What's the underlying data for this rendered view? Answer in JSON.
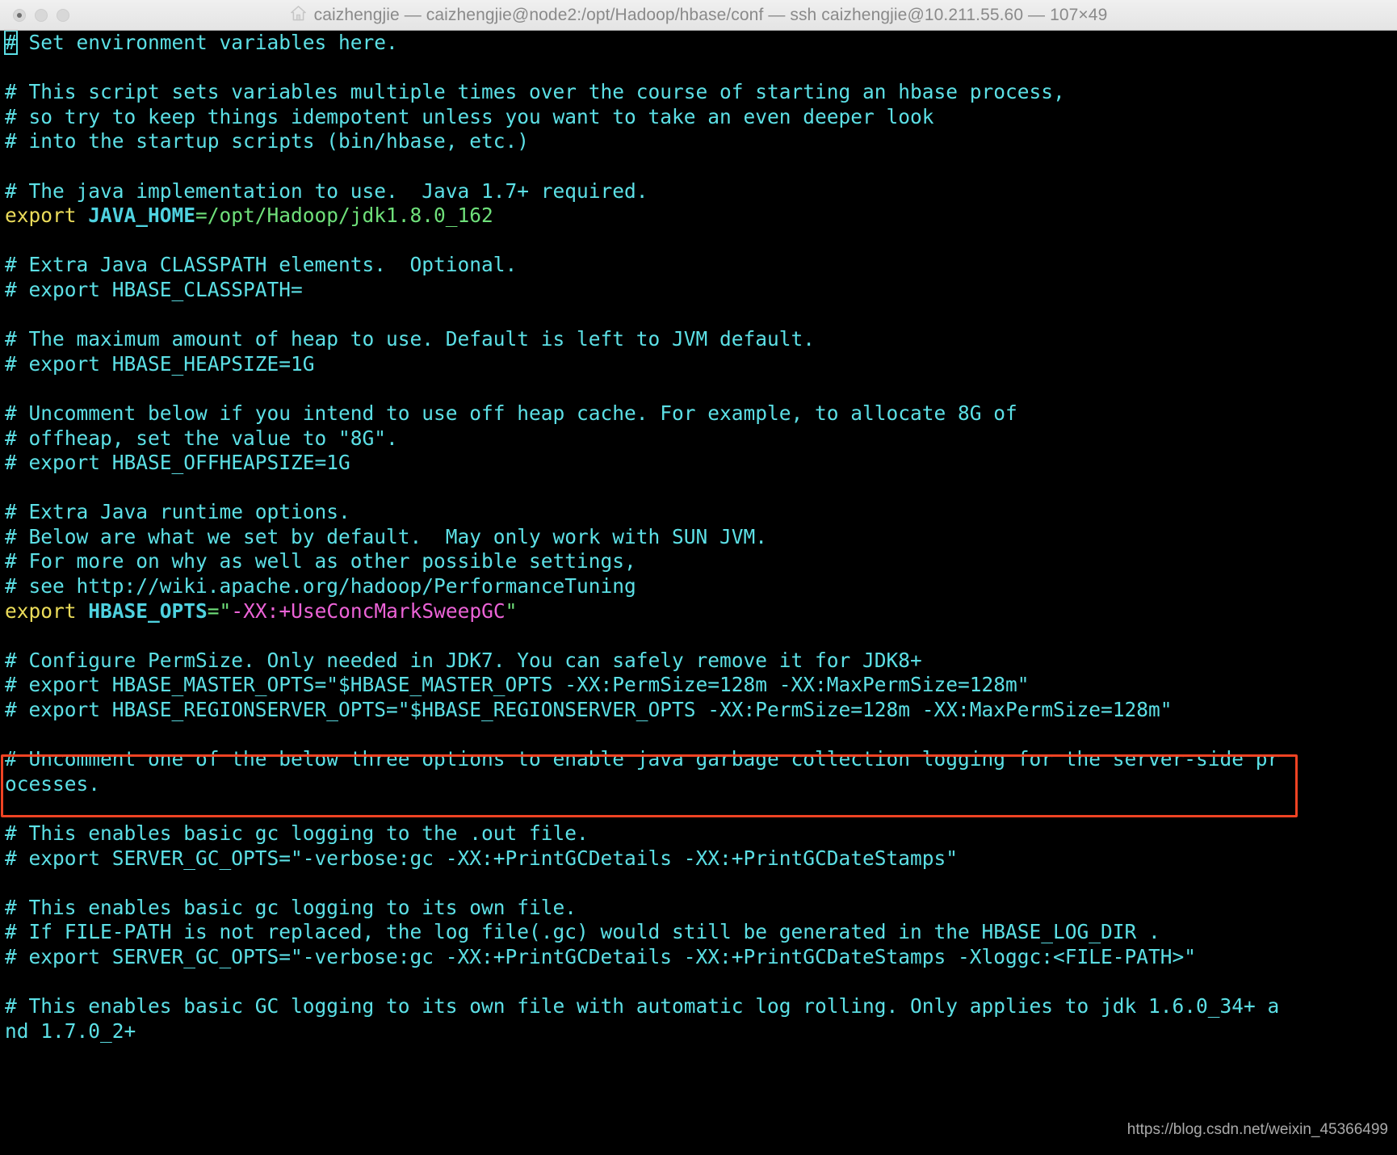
{
  "window": {
    "title": "caizhengjie — caizhengjie@node2:/opt/Hadoop/hbase/conf — ssh caizhengjie@10.211.55.60 — 107×49",
    "home_icon": "home-icon",
    "traffic_lights": [
      "close",
      "minimize",
      "zoom"
    ],
    "active": false
  },
  "theme": {
    "background": "#000000",
    "comment_color": "#5ce0e6",
    "keyword_color": "#ebdc5a",
    "variable_color": "#4fd2e0",
    "string_color": "#6fe07a",
    "value_color": "#ec63d7",
    "annotation_color": "#ef4323",
    "titlebar_bg": "#ebebeb",
    "titlebar_text": "#8a8a8a"
  },
  "annotation": {
    "type": "red-rectangle",
    "color": "#ef4323",
    "covers_lines": [
      28,
      29
    ]
  },
  "watermark": {
    "text": "https://blog.csdn.net/weixin_45366499"
  },
  "terminal": {
    "columns": 107,
    "rows": 49,
    "cursor": {
      "line": 0,
      "column": 0,
      "char": "#"
    },
    "lines": [
      {
        "segments": [
          {
            "t": "#",
            "c": "comment",
            "cursor": true
          },
          {
            "t": " Set environment variables here.",
            "c": "comment"
          }
        ]
      },
      {
        "segments": [
          {
            "t": "",
            "c": "comment"
          }
        ]
      },
      {
        "segments": [
          {
            "t": "# This script sets variables multiple times over the course of starting an hbase process,",
            "c": "comment"
          }
        ]
      },
      {
        "segments": [
          {
            "t": "# so try to keep things idempotent unless you want to take an even deeper look",
            "c": "comment"
          }
        ]
      },
      {
        "segments": [
          {
            "t": "# into the startup scripts (bin/hbase, etc.)",
            "c": "comment"
          }
        ]
      },
      {
        "segments": [
          {
            "t": "",
            "c": "comment"
          }
        ]
      },
      {
        "segments": [
          {
            "t": "# The java implementation to use.  Java 1.7+ required.",
            "c": "comment"
          }
        ]
      },
      {
        "segments": [
          {
            "t": "export",
            "c": "keyword"
          },
          {
            "t": " ",
            "c": "comment"
          },
          {
            "t": "JAVA_HOME",
            "c": "var"
          },
          {
            "t": "=/opt/Hadoop/jdk1.8.0_162",
            "c": "green"
          }
        ]
      },
      {
        "segments": [
          {
            "t": "",
            "c": "comment"
          }
        ]
      },
      {
        "segments": [
          {
            "t": "# Extra Java CLASSPATH elements.  Optional.",
            "c": "comment"
          }
        ]
      },
      {
        "segments": [
          {
            "t": "# export HBASE_CLASSPATH=",
            "c": "comment"
          }
        ]
      },
      {
        "segments": [
          {
            "t": "",
            "c": "comment"
          }
        ]
      },
      {
        "segments": [
          {
            "t": "# The maximum amount of heap to use. Default is left to JVM default.",
            "c": "comment"
          }
        ]
      },
      {
        "segments": [
          {
            "t": "# export HBASE_HEAPSIZE=1G",
            "c": "comment"
          }
        ]
      },
      {
        "segments": [
          {
            "t": "",
            "c": "comment"
          }
        ]
      },
      {
        "segments": [
          {
            "t": "# Uncomment below if you intend to use off heap cache. For example, to allocate 8G of",
            "c": "comment"
          }
        ]
      },
      {
        "segments": [
          {
            "t": "# offheap, set the value to \"8G\".",
            "c": "comment"
          }
        ]
      },
      {
        "segments": [
          {
            "t": "# export HBASE_OFFHEAPSIZE=1G",
            "c": "comment"
          }
        ]
      },
      {
        "segments": [
          {
            "t": "",
            "c": "comment"
          }
        ]
      },
      {
        "segments": [
          {
            "t": "# Extra Java runtime options.",
            "c": "comment"
          }
        ]
      },
      {
        "segments": [
          {
            "t": "# Below are what we set by default.  May only work with SUN JVM.",
            "c": "comment"
          }
        ]
      },
      {
        "segments": [
          {
            "t": "# For more on why as well as other possible settings,",
            "c": "comment"
          }
        ]
      },
      {
        "segments": [
          {
            "t": "# see http://wiki.apache.org/hadoop/PerformanceTuning",
            "c": "comment"
          }
        ]
      },
      {
        "segments": [
          {
            "t": "export",
            "c": "keyword"
          },
          {
            "t": " ",
            "c": "comment"
          },
          {
            "t": "HBASE_OPTS",
            "c": "var"
          },
          {
            "t": "=\"",
            "c": "green"
          },
          {
            "t": "-XX:+UseConcMarkSweepGC",
            "c": "magenta"
          },
          {
            "t": "\"",
            "c": "green"
          }
        ]
      },
      {
        "segments": [
          {
            "t": "",
            "c": "comment"
          }
        ]
      },
      {
        "segments": [
          {
            "t": "# Configure PermSize. Only needed in JDK7. You can safely remove it for JDK8+",
            "c": "comment"
          }
        ]
      },
      {
        "segments": [
          {
            "t": "# export HBASE_MASTER_OPTS=\"$HBASE_MASTER_OPTS -XX:PermSize=128m -XX:MaxPermSize=128m\"",
            "c": "comment"
          }
        ]
      },
      {
        "segments": [
          {
            "t": "# export HBASE_REGIONSERVER_OPTS=\"$HBASE_REGIONSERVER_OPTS -XX:PermSize=128m -XX:MaxPermSize=128m\"",
            "c": "comment"
          }
        ]
      },
      {
        "segments": [
          {
            "t": "",
            "c": "comment"
          }
        ]
      },
      {
        "segments": [
          {
            "t": "# Uncomment one of the below three options to enable java garbage collection logging for the server-side pr",
            "c": "comment"
          }
        ]
      },
      {
        "segments": [
          {
            "t": "ocesses.",
            "c": "comment"
          }
        ]
      },
      {
        "segments": [
          {
            "t": "",
            "c": "comment"
          }
        ]
      },
      {
        "segments": [
          {
            "t": "# This enables basic gc logging to the .out file.",
            "c": "comment"
          }
        ]
      },
      {
        "segments": [
          {
            "t": "# export SERVER_GC_OPTS=\"-verbose:gc -XX:+PrintGCDetails -XX:+PrintGCDateStamps\"",
            "c": "comment"
          }
        ]
      },
      {
        "segments": [
          {
            "t": "",
            "c": "comment"
          }
        ]
      },
      {
        "segments": [
          {
            "t": "# This enables basic gc logging to its own file.",
            "c": "comment"
          }
        ]
      },
      {
        "segments": [
          {
            "t": "# If FILE-PATH is not replaced, the log file(.gc) would still be generated in the HBASE_LOG_DIR .",
            "c": "comment"
          }
        ]
      },
      {
        "segments": [
          {
            "t": "# export SERVER_GC_OPTS=\"-verbose:gc -XX:+PrintGCDetails -XX:+PrintGCDateStamps -Xloggc:<FILE-PATH>\"",
            "c": "comment"
          }
        ]
      },
      {
        "segments": [
          {
            "t": "",
            "c": "comment"
          }
        ]
      },
      {
        "segments": [
          {
            "t": "# This enables basic GC logging to its own file with automatic log rolling. Only applies to jdk 1.6.0_34+ a",
            "c": "comment"
          }
        ]
      },
      {
        "segments": [
          {
            "t": "nd 1.7.0_2+",
            "c": "comment"
          }
        ]
      }
    ]
  }
}
